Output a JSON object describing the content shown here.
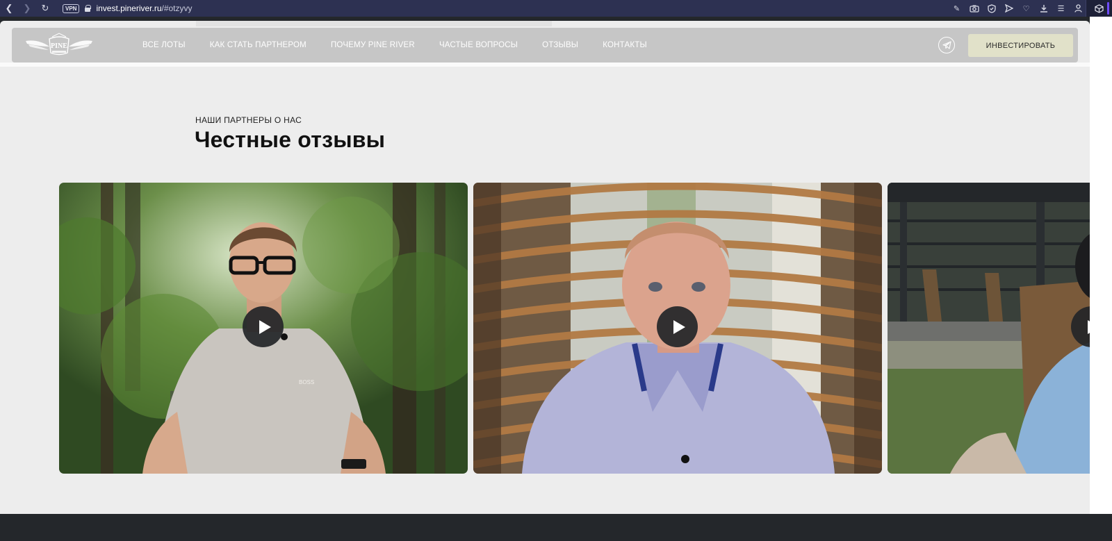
{
  "browser": {
    "url_host": "invest.pineriver.ru",
    "url_path": "/#otzyvy",
    "vpn_label": "VPN"
  },
  "header": {
    "logo_text": "PINE",
    "menu": [
      {
        "label": "ВСЕ ЛОТЫ"
      },
      {
        "label": "КАК СТАТЬ ПАРТНЕРОМ"
      },
      {
        "label": "ПОЧЕМУ PINE RIVER"
      },
      {
        "label": "ЧАСТЫЕ ВОПРОСЫ"
      },
      {
        "label": "ОТЗЫВЫ"
      },
      {
        "label": "КОНТАКТЫ"
      }
    ],
    "cta_label": "ИНВЕСТИРОВАТЬ"
  },
  "section": {
    "eyebrow": "НАШИ ПАРТНЕРЫ О НАС",
    "title": "Честные отзывы"
  },
  "colors": {
    "header_bg": "#c6c6c6",
    "cta_bg": "#e1e1c9",
    "page_bg": "#ededed",
    "browser_bar": "#2d3152",
    "footer": "#24272b"
  },
  "videos": [
    {
      "name": "review-video-1",
      "shirt_text": "BOSS"
    },
    {
      "name": "review-video-2"
    },
    {
      "name": "review-video-3"
    }
  ]
}
